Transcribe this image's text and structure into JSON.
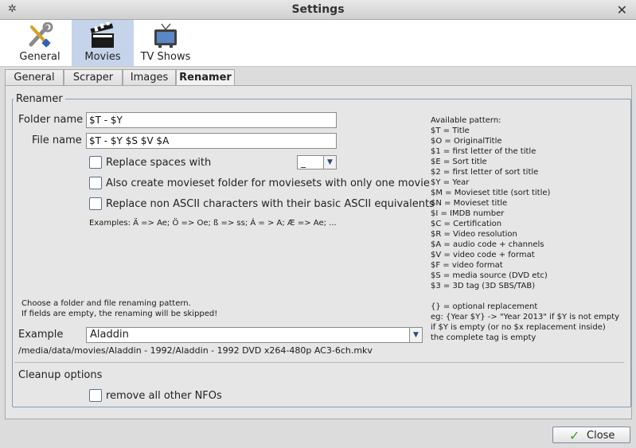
{
  "window": {
    "title": "Settings"
  },
  "toolbar": {
    "items": [
      {
        "label": "General"
      },
      {
        "label": "Movies"
      },
      {
        "label": "TV Shows"
      }
    ],
    "active": "Movies"
  },
  "subtabs": [
    {
      "label": "General"
    },
    {
      "label": "Scraper"
    },
    {
      "label": "Images"
    },
    {
      "label": "Renamer"
    }
  ],
  "renamer": {
    "group_title": "Renamer",
    "folder_label": "Folder name",
    "folder_value": "$T - $Y",
    "file_label": "File name",
    "file_value": "$T - $Y $S $V $A",
    "replace_spaces_label": "Replace spaces with",
    "replace_spaces_value": "_",
    "movieset_label": "Also create movieset folder for moviesets with only one movie",
    "ascii_label": "Replace non ASCII characters with their basic ASCII equivalents",
    "examples_text": "Examples: Ä => Ae; Ö => Oe; ß => ss; Á = > A; Æ => Ae; ...",
    "hint_line1": "Choose a folder and file renaming pattern.",
    "hint_line2": "If fields are empty, the renaming will be skipped!",
    "example_label": "Example",
    "example_value": "Aladdin",
    "example_path": "/media/data/movies/Aladdin - 1992/Aladdin - 1992 DVD x264-480p AC3-6ch.mkv",
    "cleanup_label": "Cleanup options",
    "remove_nfo_label": "remove all other NFOs"
  },
  "patterns": {
    "title": "Available pattern:",
    "items": [
      "$T = Title",
      "$O = OriginalTitle",
      "$1 = first letter of the title",
      "$E = Sort title",
      "$2 = first letter of sort title",
      "$Y = Year",
      "$M = Movieset title (sort title)",
      "$N = Movieset title",
      "$I = IMDB number",
      "$C = Certification",
      "$R = Video resolution",
      "$A = audio code + channels",
      "$V = video code + format",
      "$F = video format",
      "$S = media source (DVD etc)",
      "$3 = 3D tag (3D SBS/TAB)"
    ],
    "optional": [
      "{} = optional replacement",
      " eg: {Year $Y} -> \"Year 2013\" if $Y is not empty",
      " if $Y is empty (or no $x replacement inside)",
      " the complete tag is empty"
    ]
  },
  "footer": {
    "close_label": "Close"
  }
}
